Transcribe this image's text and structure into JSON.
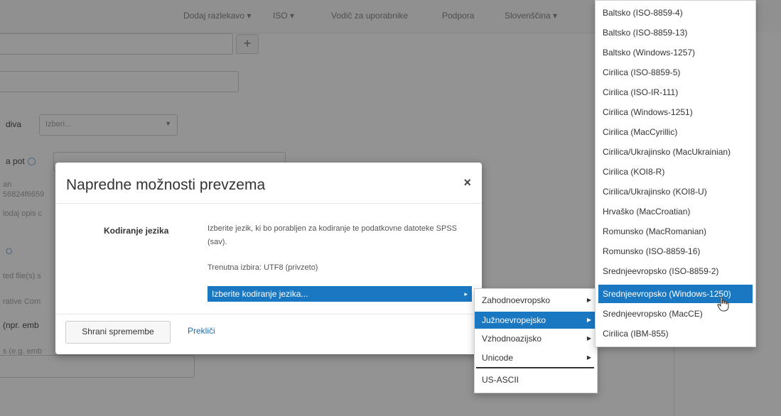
{
  "background": {
    "nav": [
      "Dodaj razlekavo ▾",
      "ISO ▾",
      "Vodič za uporabnike",
      "Podpora",
      "Slovenščina ▾"
    ],
    "row_label_diva": "diva",
    "select_placeholder": "Izberi...",
    "row_label_pot": "a pot",
    "muted_1": "an",
    "muted_2": "56824f6659",
    "muted_3": "lodaj opis c",
    "row_label_o": "O",
    "muted_4": "ted file(s) s",
    "muted_5": "rative Com",
    "row_label_opr": "(npr. emb",
    "muted_6": "s (e.g. emb"
  },
  "modal": {
    "title": "Napredne možnosti prevzema",
    "close_symbol": "×",
    "encoding_label": "Kodiranje jezika",
    "help_text": "Izberite jezik, ki bo porabljen za kodiranje te podatkovne datoteke SPSS (sav).",
    "current_selection": "Trenutna izbira: UTF8 (privzeto)",
    "dropdown_label": "Izberite kodiranje jezika...",
    "save_button": "Shrani spremembe",
    "cancel_button": "Prekliči"
  },
  "submenu_level1": {
    "items": [
      {
        "label": "Zahodnoevropsko",
        "has_submenu": true,
        "active": false
      },
      {
        "label": "Južnoevropejsko",
        "has_submenu": true,
        "active": true
      },
      {
        "label": "Vzhodnoazijsko",
        "has_submenu": true,
        "active": false
      },
      {
        "label": "Unicode",
        "has_submenu": true,
        "active": false
      },
      {
        "label": "US-ASCII",
        "has_submenu": false,
        "active": false
      }
    ]
  },
  "submenu_level2": {
    "items": [
      {
        "label": "Baltsko (ISO-8859-4)",
        "active": false
      },
      {
        "label": "Baltsko (ISO-8859-13)",
        "active": false
      },
      {
        "label": "Baltsko (Windows-1257)",
        "active": false
      },
      {
        "label": "Cirilica (ISO-8859-5)",
        "active": false
      },
      {
        "label": "Cirilica (ISO-IR-111)",
        "active": false
      },
      {
        "label": "Cirilica (Windows-1251)",
        "active": false
      },
      {
        "label": "Cirilica (MacCyrillic)",
        "active": false
      },
      {
        "label": "Cirilica/Ukrajinsko (MacUkrainian)",
        "active": false
      },
      {
        "label": "Cirilica (KOI8-R)",
        "active": false
      },
      {
        "label": "Cirilica/Ukrajinsko (KOI8-U)",
        "active": false
      },
      {
        "label": "Hrvaško (MacCroatian)",
        "active": false
      },
      {
        "label": "Romunsko (MacRomanian)",
        "active": false
      },
      {
        "label": "Romunsko (ISO-8859-16)",
        "active": false
      },
      {
        "label": "Srednjeevropsko (ISO-8859-2)",
        "active": false
      },
      {
        "label": "Srednjeevropsko (Windows-1250)",
        "active": true
      },
      {
        "label": "Srednjeevropsko (MacCE)",
        "active": false
      },
      {
        "label": "Cirilica (IBM-855)",
        "active": false
      }
    ]
  },
  "colors": {
    "accent": "#1a78c2",
    "link": "#1a6fb5"
  }
}
